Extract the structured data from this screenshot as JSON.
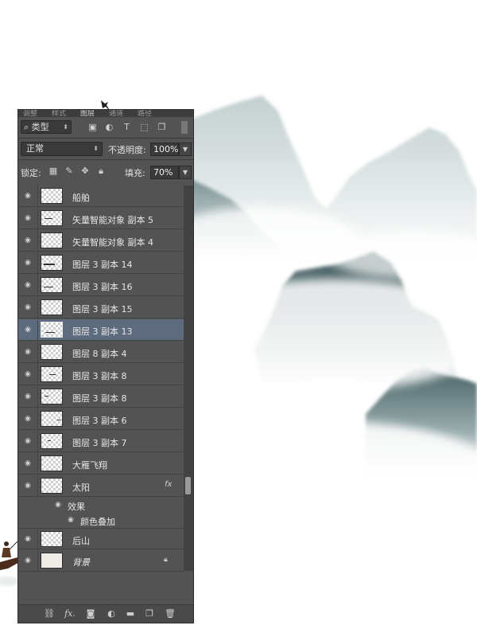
{
  "panel": {
    "tabs": [
      "调整",
      "样式",
      "图层",
      "通道",
      "路径"
    ],
    "active_tab": "图层",
    "filter": {
      "type_value": "类型",
      "icons": [
        "image-filter-icon",
        "adjustment-filter-icon",
        "type-filter-icon",
        "shape-filter-icon",
        "smart-object-filter-icon",
        "filter-toggle-icon"
      ]
    },
    "blend_mode": "正常",
    "opacity_label": "不透明度:",
    "opacity_value": "100%",
    "lock_label": "锁定:",
    "lock_icons": [
      "lock-transparent-icon",
      "lock-pixels-icon",
      "lock-position-icon",
      "lock-all-icon"
    ],
    "fill_label": "填充:",
    "fill_value": "70%",
    "layers": [
      {
        "name": "船舶",
        "italic": false
      },
      {
        "name": "矢量智能对象 副本 5",
        "italic": false
      },
      {
        "name": "矢量智能对象 副本 4",
        "italic": false
      },
      {
        "name": "图层 3 副本 14",
        "italic": false
      },
      {
        "name": "图层 3 副本 16",
        "italic": false
      },
      {
        "name": "图层 3 副本 15",
        "italic": false
      },
      {
        "name": "图层 3 副本 13",
        "italic": false,
        "selected": true
      },
      {
        "name": "图层 8 副本 4",
        "italic": false
      },
      {
        "name": "图层 3 副本 8",
        "italic": false
      },
      {
        "name": "图层 3 副本 8",
        "italic": false
      },
      {
        "name": "图层 3 副本 6",
        "italic": false
      },
      {
        "name": "图层 3 副本 7",
        "italic": false
      },
      {
        "name": "大雁飞翔",
        "italic": false
      },
      {
        "name": "太阳",
        "italic": false,
        "fx": "fx"
      },
      {
        "name": "后山",
        "italic": false
      },
      {
        "name": "背景",
        "italic": true,
        "locked": true
      }
    ],
    "effects_label": "效果",
    "effect_item": "颜色叠加",
    "bottom_icons": [
      "link-layers-icon",
      "fx-icon",
      "layer-mask-icon",
      "adjustment-layer-icon",
      "new-group-icon",
      "new-layer-icon",
      "delete-layer-icon"
    ]
  },
  "colors": {
    "panel_bg": "#535353",
    "selected_row": "#5e6a7d",
    "mountain_dark": "#3e5a5e",
    "mountain_light": "#b9c7c8"
  }
}
